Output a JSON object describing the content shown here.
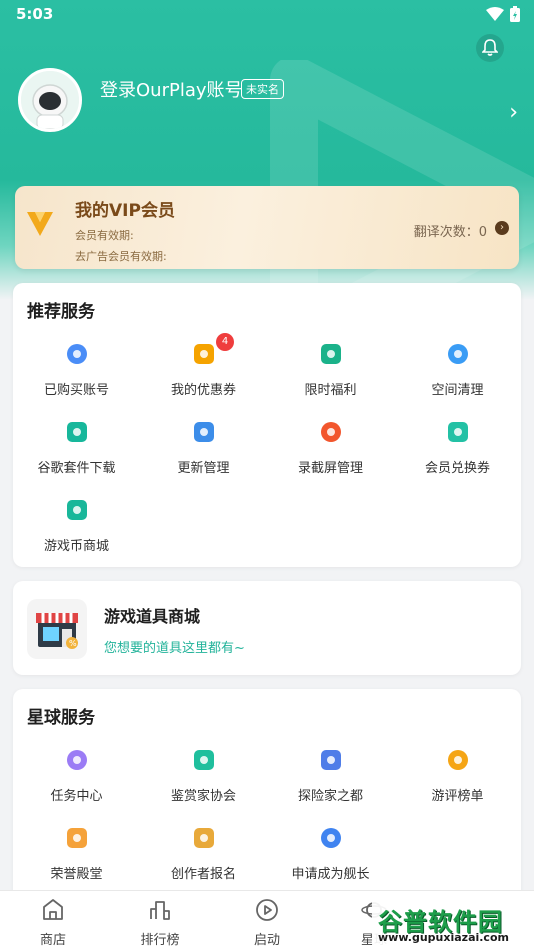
{
  "status_bar": {
    "time": "5:03"
  },
  "profile": {
    "login_text": "登录OurPlay账号",
    "verify_badge": "未实名"
  },
  "vip": {
    "title": "我的VIP会员",
    "member_validity": "会员有效期:",
    "ad_free_validity": "去广告会员有效期:",
    "translate_count": "翻译次数：0"
  },
  "recommended": {
    "title": "推荐服务",
    "items": [
      {
        "label": "已购买账号",
        "icon": "purchased-account-icon",
        "color": "#4a8df7"
      },
      {
        "label": "我的优惠券",
        "icon": "coupon-icon",
        "color": "#f5a300",
        "badge": "4"
      },
      {
        "label": "限时福利",
        "icon": "limited-benefit-icon",
        "color": "#1bb28a"
      },
      {
        "label": "空间清理",
        "icon": "space-clean-icon",
        "color": "#3a9cf5"
      },
      {
        "label": "谷歌套件下载",
        "icon": "google-suite-download-icon",
        "color": "#17b79b"
      },
      {
        "label": "更新管理",
        "icon": "update-manage-icon",
        "color": "#3c8de9"
      },
      {
        "label": "录截屏管理",
        "icon": "screen-record-icon",
        "color": "#f2562d"
      },
      {
        "label": "会员兑换券",
        "icon": "member-voucher-icon",
        "color": "#23c1a5"
      },
      {
        "label": "游戏币商城",
        "icon": "game-coin-mall-icon",
        "color": "#19b79a"
      }
    ]
  },
  "shop": {
    "title": "游戏道具商城",
    "subtitle": "您想要的道具这里都有~"
  },
  "planet": {
    "title": "星球服务",
    "items": [
      {
        "label": "任务中心",
        "icon": "task-center-icon",
        "color": "#9b7cf5"
      },
      {
        "label": "鉴赏家协会",
        "icon": "connoisseur-icon",
        "color": "#1fbf9d"
      },
      {
        "label": "探险家之都",
        "icon": "explorer-castle-icon",
        "color": "#4f7de8"
      },
      {
        "label": "游评榜单",
        "icon": "review-rank-icon",
        "color": "#f5a515"
      },
      {
        "label": "荣誉殿堂",
        "icon": "honor-hall-icon",
        "color": "#f5a23a"
      },
      {
        "label": "创作者报名",
        "icon": "creator-signup-icon",
        "color": "#e8a93a"
      },
      {
        "label": "申请成为舰长",
        "icon": "captain-apply-icon",
        "color": "#3f83f0"
      }
    ]
  },
  "bottom_nav": {
    "items": [
      {
        "label": "商店",
        "icon": "store-icon"
      },
      {
        "label": "排行榜",
        "icon": "ranking-icon"
      },
      {
        "label": "启动",
        "icon": "launch-play-icon"
      },
      {
        "label": "星球",
        "icon": "planet-icon"
      }
    ]
  },
  "watermark": {
    "name": "谷普软件园",
    "url": "www.gupuxiazai.com"
  }
}
